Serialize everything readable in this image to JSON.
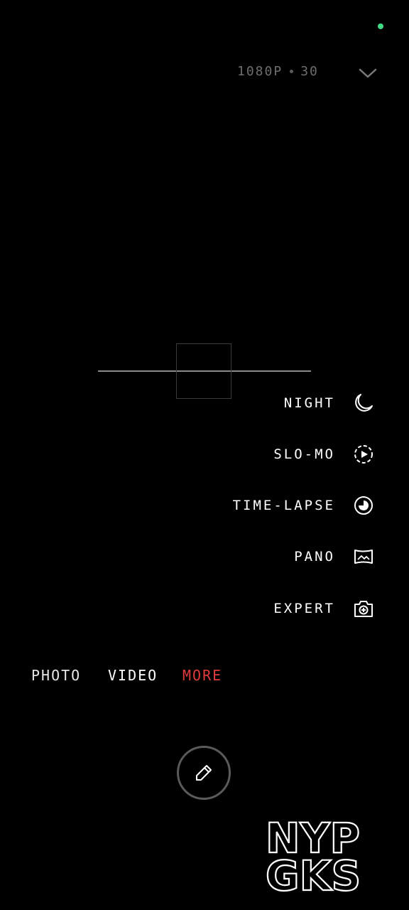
{
  "status": {
    "indicator_color": "#3ddc84"
  },
  "top_bar": {
    "resolution": "1080P",
    "fps": "30",
    "expand_icon": "chevron-down-icon"
  },
  "modes": [
    {
      "label": "NIGHT",
      "icon": "moon-icon"
    },
    {
      "label": "SLO-MO",
      "icon": "slow-motion-icon"
    },
    {
      "label": "TIME-LAPSE",
      "icon": "time-lapse-icon"
    },
    {
      "label": "PANO",
      "icon": "panorama-icon"
    },
    {
      "label": "EXPERT",
      "icon": "expert-camera-icon"
    }
  ],
  "tabs": {
    "photo": "PHOTO",
    "video": "VIDEO",
    "more": "MORE",
    "active_color": "#e03a3a"
  },
  "shutter": {
    "icon": "edit-pencil-icon"
  },
  "watermark": {
    "line1": "NYP",
    "line2": "GKS"
  }
}
